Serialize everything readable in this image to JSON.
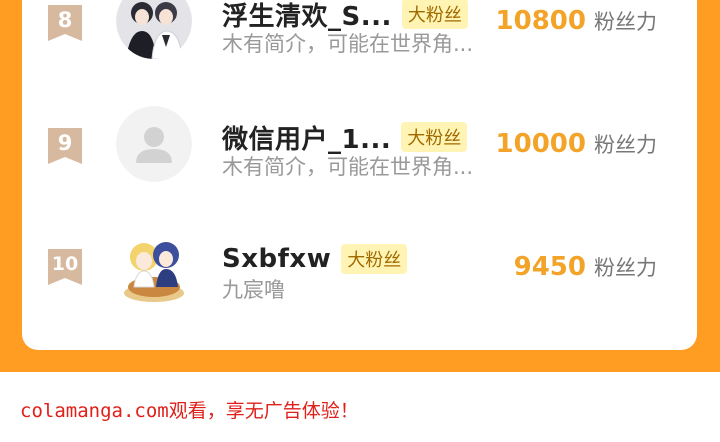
{
  "ranking": {
    "rows": [
      {
        "rank": "8",
        "name": "浮生清欢_S...",
        "badge": "大粉丝",
        "bio": "木有简介，可能在世界角...",
        "score": "10800",
        "unit": "粉丝力",
        "avatar": "anime-couple-avatar"
      },
      {
        "rank": "9",
        "name": "微信用户_1...",
        "badge": "大粉丝",
        "bio": "木有简介，可能在世界角...",
        "score": "10000",
        "unit": "粉丝力",
        "avatar": "default-user-avatar"
      },
      {
        "rank": "10",
        "name": "Sxbfxw",
        "badge": "大粉丝",
        "bio": "九宸噜",
        "score": "9450",
        "unit": "粉丝力",
        "avatar": "anime-chibi-avatar"
      }
    ]
  },
  "footer": {
    "text": "colamanga.com观看，享无广告体验！"
  },
  "colors": {
    "background": "#ff9c22",
    "rank_badge": "#d7b99f",
    "score": "#f2a328",
    "fan_badge_bg": "#fff4b3",
    "footer_text": "#e0201a"
  }
}
